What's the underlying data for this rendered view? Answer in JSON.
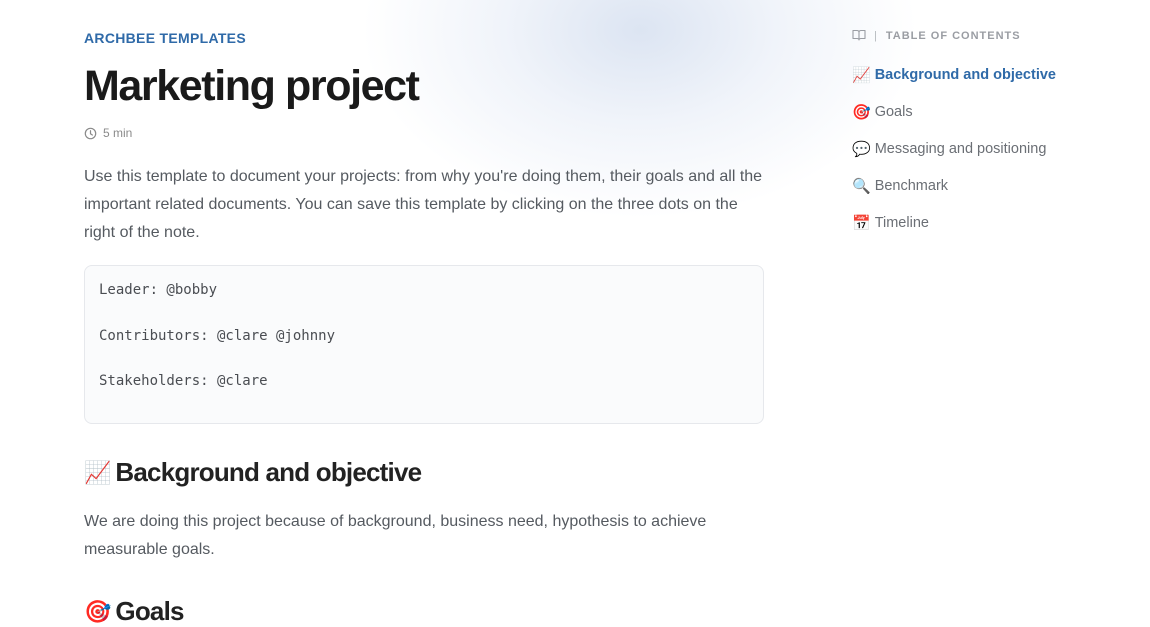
{
  "header": {
    "eyebrow": "ARCHBEE TEMPLATES",
    "title": "Marketing project",
    "read_time": "5 min"
  },
  "intro": "Use this template to document your projects: from why you're doing them, their goals and all the important related documents. You can save this template by clicking on the three dots on the right of the note.",
  "code_block": {
    "lines": [
      "Leader: @bobby",
      "Contributors: @clare @johnny",
      "Stakeholders: @clare"
    ]
  },
  "sections": [
    {
      "emoji": "📈",
      "title": "Background and objective",
      "body": "We are doing this project because of background, business need, hypothesis to achieve measurable goals."
    },
    {
      "emoji": "🎯",
      "title": "Goals"
    }
  ],
  "toc": {
    "header": "TABLE OF CONTENTS",
    "separator": "|",
    "items": [
      {
        "emoji": "📈",
        "label": "Background and objective",
        "active": true
      },
      {
        "emoji": "🎯",
        "label": "Goals"
      },
      {
        "emoji": "💬",
        "label": "Messaging and positioning"
      },
      {
        "emoji": "🔍",
        "label": "Benchmark"
      },
      {
        "emoji": "📅",
        "label": "Timeline"
      }
    ]
  },
  "colors": {
    "accent": "#2f6aa8",
    "text": "#1a1a1a",
    "muted": "#555a60"
  }
}
